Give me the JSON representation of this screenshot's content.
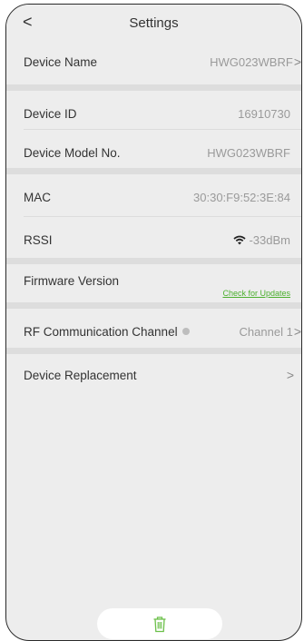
{
  "header": {
    "back_glyph": "<",
    "title": "Settings"
  },
  "rows": {
    "device_name": {
      "label": "Device Name",
      "value": "HWG023WBRF",
      "chevron": ">"
    },
    "device_id": {
      "label": "Device ID",
      "value": "16910730"
    },
    "model_no": {
      "label": "Device Model No.",
      "value": "HWG023WBRF"
    },
    "mac": {
      "label": "MAC",
      "value": "30:30:F9:52:3E:84"
    },
    "rssi": {
      "label": "RSSI",
      "value": "-33dBm",
      "icon": "wifi-icon"
    },
    "firmware": {
      "label": "Firmware Version",
      "link": "Check for Updates"
    },
    "rf_channel": {
      "label": "RF Communication Channel",
      "value": "Channel 1",
      "chevron": ">",
      "icon": "info-icon"
    },
    "replacement": {
      "label": "Device Replacement",
      "chevron": ">"
    }
  },
  "footer": {
    "delete_icon": "trash-icon"
  },
  "colors": {
    "background": "#ededed",
    "separator_band": "#dddddd",
    "link": "#4caf2f",
    "icon_green": "#6cc04a"
  }
}
